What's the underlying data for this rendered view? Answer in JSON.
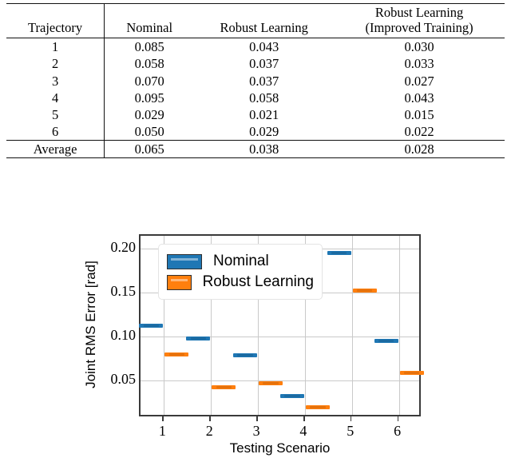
{
  "table": {
    "headers": [
      "Trajectory",
      "Nominal",
      "Robust Learning",
      "Robust Learning"
    ],
    "header4_line2": "(Improved Training)",
    "rows": [
      {
        "trajectory": "1",
        "nominal": "0.085",
        "robust": "0.043",
        "robust_improved": "0.030"
      },
      {
        "trajectory": "2",
        "nominal": "0.058",
        "robust": "0.037",
        "robust_improved": "0.033"
      },
      {
        "trajectory": "3",
        "nominal": "0.070",
        "robust": "0.037",
        "robust_improved": "0.027"
      },
      {
        "trajectory": "4",
        "nominal": "0.095",
        "robust": "0.058",
        "robust_improved": "0.043"
      },
      {
        "trajectory": "5",
        "nominal": "0.029",
        "robust": "0.021",
        "robust_improved": "0.015"
      },
      {
        "trajectory": "6",
        "nominal": "0.050",
        "robust": "0.029",
        "robust_improved": "0.022"
      }
    ],
    "average": {
      "trajectory": "Average",
      "nominal": "0.065",
      "robust": "0.038",
      "robust_improved": "0.028"
    }
  },
  "chart_data": {
    "type": "bar",
    "title": "",
    "xlabel": "Testing Scenario",
    "ylabel": "Joint RMS Error [rad]",
    "categories": [
      "1",
      "2",
      "3",
      "4",
      "5",
      "6"
    ],
    "series": [
      {
        "name": "Nominal",
        "color": "#1f77b4",
        "values": [
          0.112,
          0.098,
          0.078,
          0.032,
          0.195,
          0.095
        ]
      },
      {
        "name": "Robust Learning",
        "color": "#ff7f0e",
        "values": [
          0.079,
          0.042,
          0.047,
          0.019,
          0.152,
          0.058
        ]
      }
    ],
    "ylim": [
      0.007,
      0.2145
    ],
    "yticks": [
      0.05,
      0.1,
      0.15,
      0.2
    ],
    "ytick_labels": [
      "0.05",
      "0.10",
      "0.15",
      "0.20"
    ],
    "xlim": [
      0.5,
      6.5
    ],
    "grid": true,
    "legend_position": "upper left",
    "legend_entries": [
      "Nominal",
      "Robust Learning"
    ]
  }
}
